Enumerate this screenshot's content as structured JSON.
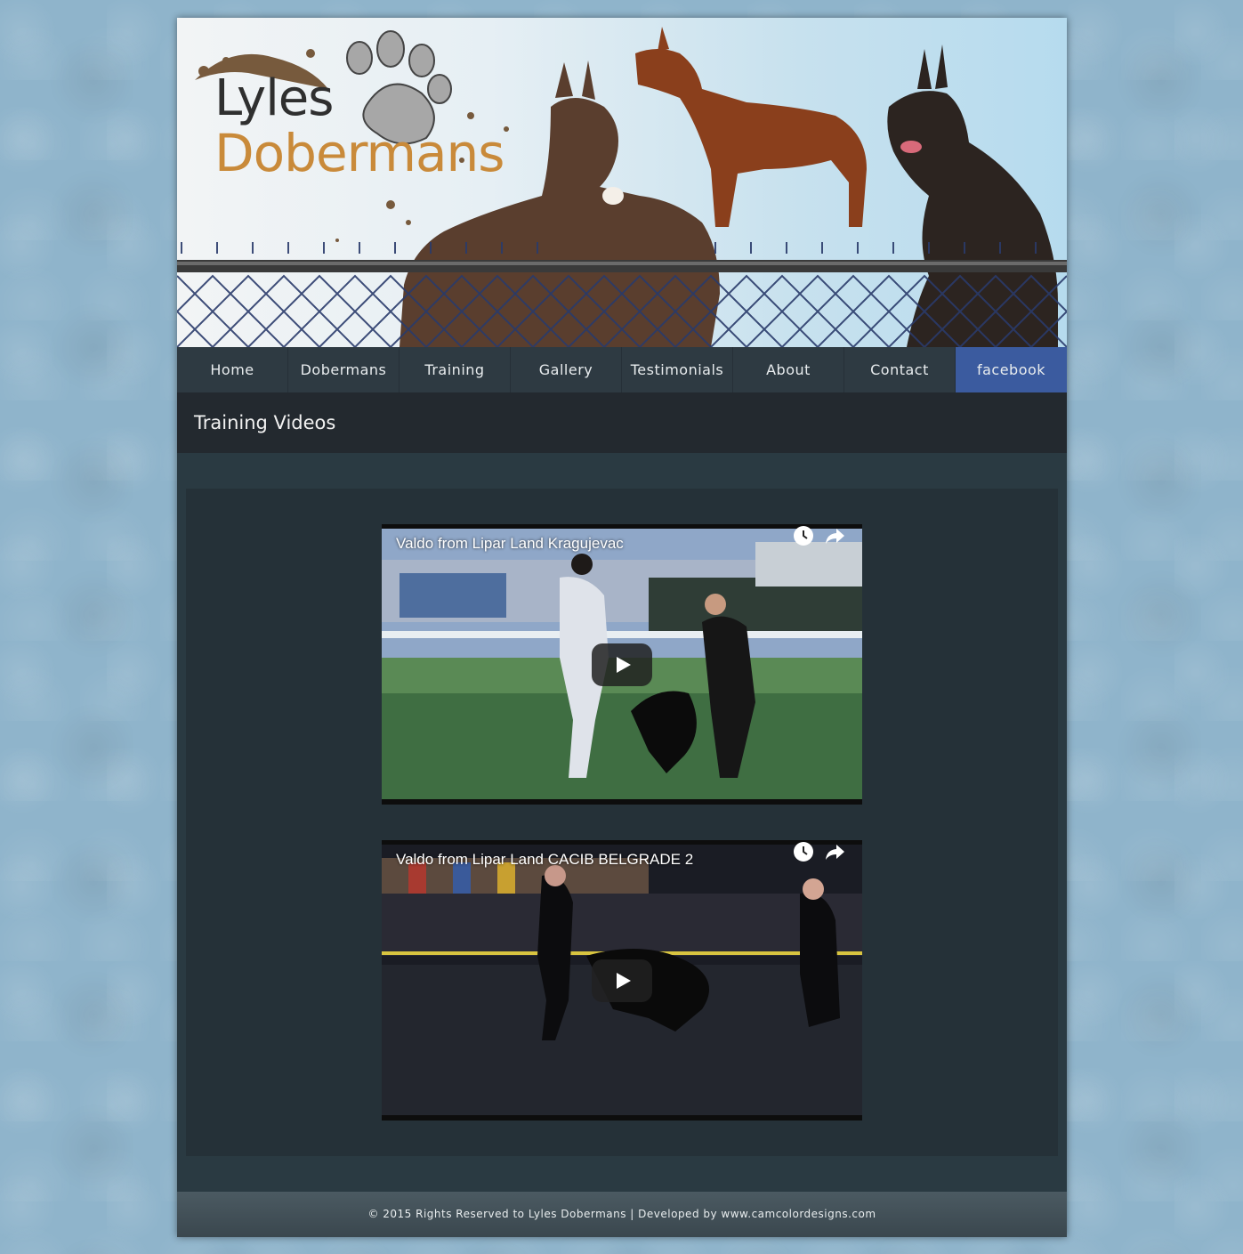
{
  "header": {
    "logo_line1": "Lyles",
    "logo_line2": "Dobermans"
  },
  "nav": {
    "items": [
      {
        "label": "Home"
      },
      {
        "label": "Dobermans"
      },
      {
        "label": "Training"
      },
      {
        "label": "Gallery"
      },
      {
        "label": "Testimonials"
      },
      {
        "label": "About"
      },
      {
        "label": "Contact"
      },
      {
        "label": "facebook"
      }
    ]
  },
  "page": {
    "title": "Training Videos"
  },
  "videos": [
    {
      "title": "Valdo from Lipar Land Kragujevac",
      "icons": [
        "watch-later-icon",
        "share-icon",
        "play-icon"
      ]
    },
    {
      "title": "Valdo from Lipar Land CACIB BELGRADE 2",
      "icons": [
        "watch-later-icon",
        "share-icon",
        "play-icon"
      ]
    }
  ],
  "footer": {
    "text": "© 2015 Rights Reserved to Lyles Dobermans | Developed by www.camcolordesigns.com"
  },
  "colors": {
    "nav_bg": "#2e3a42",
    "facebook_bg": "#3b5b9f",
    "logo_orange": "#c98a3a",
    "page_bg": "#8fb4cb"
  }
}
